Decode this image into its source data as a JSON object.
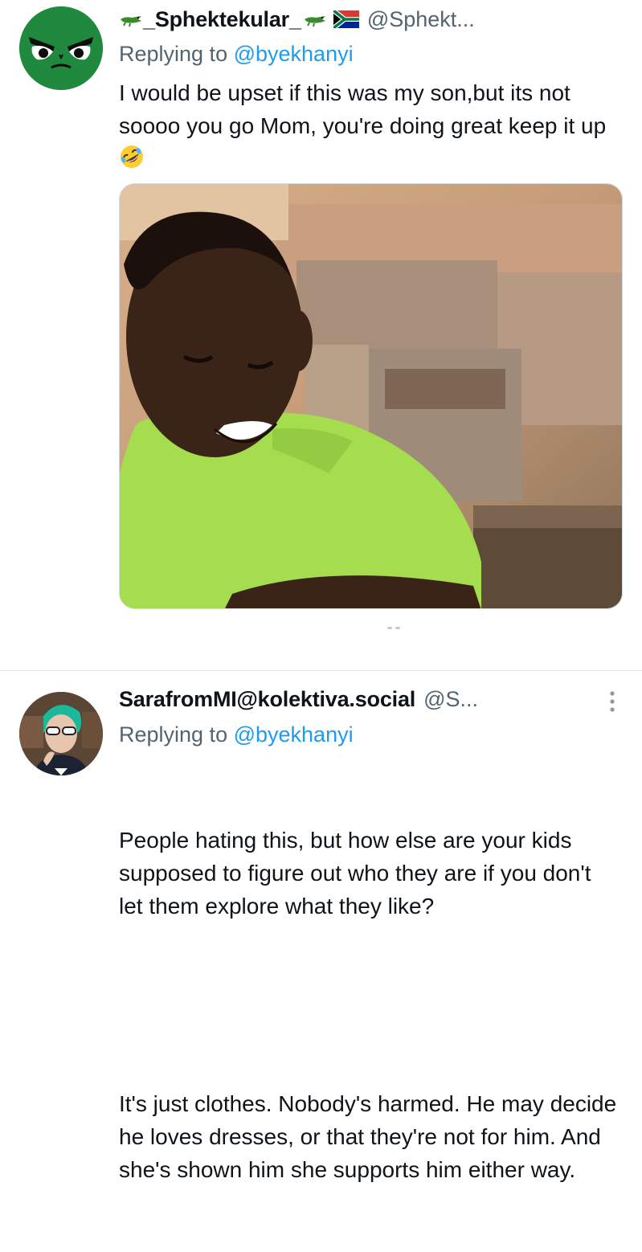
{
  "tweets": [
    {
      "display_name": "_Sphektekular_",
      "handle": "@Sphekt...",
      "flag_icon": "south-africa-flag-icon",
      "replying_prefix": "Replying to ",
      "replying_to": "@byekhanyi",
      "text": "I would be upset if this was my son,but its not soooo you go Mom, you're doing great keep it up",
      "emoji": "rolling-on-floor-laughing-emoji",
      "media": {
        "description_icon": "meme-photo"
      }
    },
    {
      "display_name": "SarafromMI@kolektiva.social",
      "handle": "@S...",
      "replying_prefix": "Replying to ",
      "replying_to": "@byekhanyi",
      "paragraphs": [
        "People hating this, but how else are your kids supposed to figure out who they are if you don't let them explore what they like?",
        "It's just clothes. Nobody's harmed. He may decide he loves dresses, or that they're not for him. And she's shown him she supports him either way."
      ],
      "more_icon": "more-vertical-icon"
    }
  ],
  "colors": {
    "text": "#0f1419",
    "secondary": "#536471",
    "link": "#1d9bf0",
    "divider": "#e3e7ea"
  }
}
